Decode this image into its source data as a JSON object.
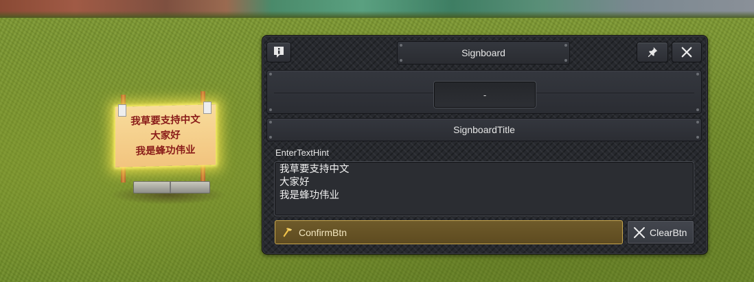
{
  "world": {
    "signboard_lines": [
      "我草要支持中文",
      "大家好",
      "我是蜂功伟业"
    ]
  },
  "panel": {
    "header": {
      "title": "Signboard",
      "info_icon": "info-icon",
      "pin_icon": "pin-icon",
      "close_icon": "close-icon"
    },
    "value_field": "-",
    "section_title": "SignboardTitle",
    "hint_label": "EnterTextHint",
    "text_lines": [
      "我草要支持中文",
      "大家好",
      "我是蜂功伟业"
    ],
    "confirm": {
      "label": "ConfirmBtn",
      "icon": "hammer-icon"
    },
    "clear": {
      "label": "ClearBtn",
      "icon": "x-icon"
    }
  },
  "colors": {
    "confirm_border": "#c9a84e",
    "confirm_bg": "#5e4b20",
    "panel_bg": "#27292e",
    "sign_text": "#8a1d1a",
    "sign_glow": "#ffeb50"
  }
}
